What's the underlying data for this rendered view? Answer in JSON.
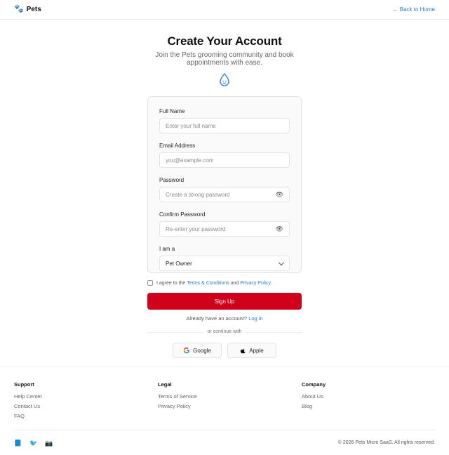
{
  "header": {
    "brand": "Pets",
    "back_link": "← Back to Home"
  },
  "hero": {
    "title": "Create Your Account",
    "subtitle": "Join the Pets grooming community and book appointments with ease."
  },
  "form": {
    "full_name": {
      "label": "Full Name",
      "placeholder": "Enter your full name"
    },
    "email": {
      "label": "Email Address",
      "placeholder": "you@example.com"
    },
    "password": {
      "label": "Password",
      "placeholder": "Create a strong password"
    },
    "confirm_password": {
      "label": "Confirm Password",
      "placeholder": "Re-enter your password"
    },
    "role": {
      "label": "I am a",
      "selected": "Pet Owner"
    },
    "agree": {
      "prefix": "I agree to the",
      "terms": "Terms & Conditions",
      "and": "and",
      "privacy": "Privacy Policy",
      "suffix": "."
    },
    "submit": "Sign Up",
    "already": {
      "text": "Already have an account?",
      "login": "Log in"
    },
    "divider": "or continue with",
    "google": "Google",
    "apple": "Apple"
  },
  "footer": {
    "support": {
      "heading": "Support",
      "links": [
        "Help Center",
        "Contact Us",
        "FAQ"
      ]
    },
    "legal": {
      "heading": "Legal",
      "links": [
        "Terms of Service",
        "Privacy Policy"
      ]
    },
    "company": {
      "heading": "Company",
      "links": [
        "About Us",
        "Blog"
      ]
    },
    "copyright": "© 2026 Pets Micro SaaS. All rights reserved.",
    "social_icons": [
      "facebook-icon",
      "twitter-icon",
      "instagram-icon"
    ]
  },
  "colors": {
    "accent": "#d0021b",
    "link": "#2a7be0"
  }
}
